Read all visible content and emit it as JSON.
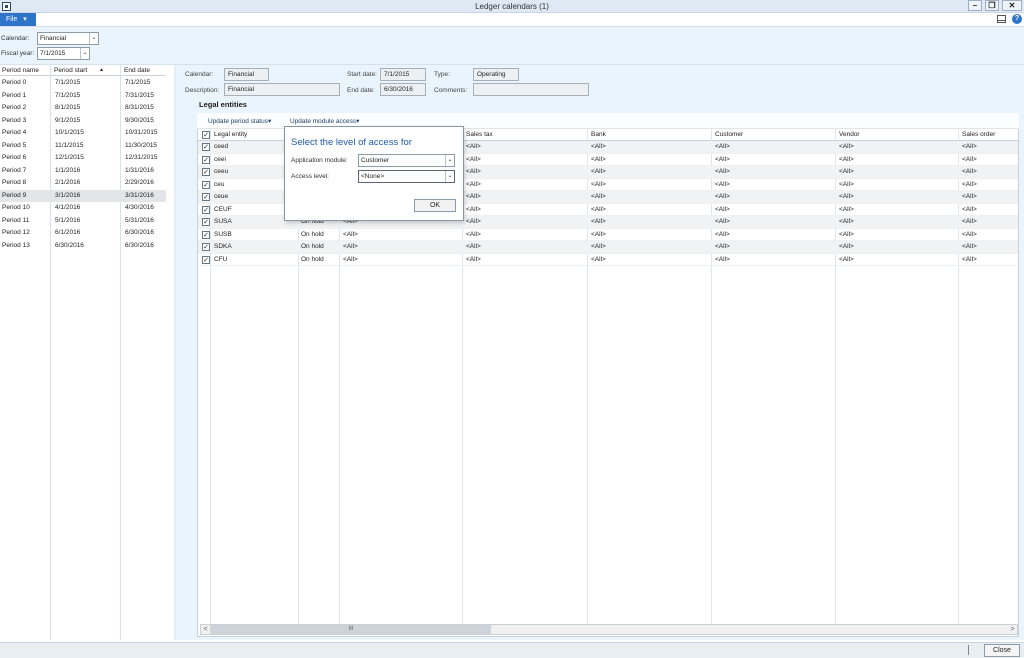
{
  "window": {
    "title": "Ledger calendars (1)",
    "minimize_glyph": "–",
    "restore_glyph": "❐",
    "close_glyph": "✕"
  },
  "ribbon": {
    "file_label": "File",
    "file_arrow": "▾",
    "help_glyph": "?"
  },
  "filters": {
    "calendar_label": "Calendar:",
    "calendar_value": "Financial",
    "fiscal_year_label": "Fiscal year:",
    "fiscal_year_value": "7/1/2015",
    "dropdown_glyph": "⌄"
  },
  "periods": {
    "headers": {
      "name": "Period name",
      "start": "Period start",
      "end": "End date",
      "sort_glyph": "▲"
    },
    "selected_index": 9,
    "rows": [
      {
        "name": "Period 0",
        "start": "7/1/2015",
        "end": "7/1/2015"
      },
      {
        "name": "Period 1",
        "start": "7/1/2015",
        "end": "7/31/2015"
      },
      {
        "name": "Period 2",
        "start": "8/1/2015",
        "end": "8/31/2015"
      },
      {
        "name": "Period 3",
        "start": "9/1/2015",
        "end": "9/30/2015"
      },
      {
        "name": "Period 4",
        "start": "10/1/2015",
        "end": "10/31/2015"
      },
      {
        "name": "Period 5",
        "start": "11/1/2015",
        "end": "11/30/2015"
      },
      {
        "name": "Period 6",
        "start": "12/1/2015",
        "end": "12/31/2015"
      },
      {
        "name": "Period 7",
        "start": "1/1/2016",
        "end": "1/31/2016"
      },
      {
        "name": "Period 8",
        "start": "2/1/2016",
        "end": "2/29/2016"
      },
      {
        "name": "Period 9",
        "start": "3/1/2016",
        "end": "3/31/2016"
      },
      {
        "name": "Period 10",
        "start": "4/1/2016",
        "end": "4/30/2016"
      },
      {
        "name": "Period 11",
        "start": "5/1/2016",
        "end": "5/31/2016"
      },
      {
        "name": "Period 12",
        "start": "6/1/2016",
        "end": "6/30/2016"
      },
      {
        "name": "Period 13",
        "start": "6/30/2016",
        "end": "6/30/2016"
      }
    ]
  },
  "details": {
    "calendar_label": "Calendar:",
    "calendar_value": "Financial",
    "description_label": "Description:",
    "description_value": "Financial",
    "start_date_label": "Start date:",
    "start_date_value": "7/1/2015",
    "end_date_label": "End date:",
    "end_date_value": "6/30/2016",
    "type_label": "Type:",
    "type_value": "Operating",
    "comments_label": "Comments:",
    "comments_value": ""
  },
  "legal_entities": {
    "title": "Legal entities",
    "toolbar": {
      "update_period_status": "Update period status",
      "update_module_access": "Update module access",
      "dropdown_glyph": "▾"
    },
    "headers": {
      "legal_entity": "Legal entity",
      "sales_tax": "Sales tax",
      "bank": "Bank",
      "customer": "Customer",
      "vendor": "Vendor",
      "sales_order": "Sales order"
    },
    "check_glyph": "✓",
    "rows": [
      {
        "entity": "ceed",
        "status": "",
        "v1": "",
        "v2": "<All>",
        "v3": "<All>",
        "v4": "<All>",
        "v5": "<All>",
        "v6": "<All>"
      },
      {
        "entity": "ceei",
        "status": "",
        "v1": "",
        "v2": "<All>",
        "v3": "<All>",
        "v4": "<All>",
        "v5": "<All>",
        "v6": "<All>"
      },
      {
        "entity": "ceeu",
        "status": "",
        "v1": "",
        "v2": "<All>",
        "v3": "<All>",
        "v4": "<All>",
        "v5": "<All>",
        "v6": "<All>"
      },
      {
        "entity": "ceu",
        "status": "",
        "v1": "",
        "v2": "<All>",
        "v3": "<All>",
        "v4": "<All>",
        "v5": "<All>",
        "v6": "<All>"
      },
      {
        "entity": "ceue",
        "status": "",
        "v1": "",
        "v2": "<All>",
        "v3": "<All>",
        "v4": "<All>",
        "v5": "<All>",
        "v6": "<All>"
      },
      {
        "entity": "CEUF",
        "status": "",
        "v1": "",
        "v2": "<All>",
        "v3": "<All>",
        "v4": "<All>",
        "v5": "<All>",
        "v6": "<All>"
      },
      {
        "entity": "SUSA",
        "status": "On hold",
        "v1": "<All>",
        "v2": "<All>",
        "v3": "<All>",
        "v4": "<All>",
        "v5": "<All>",
        "v6": "<All>"
      },
      {
        "entity": "SUSB",
        "status": "On hold",
        "v1": "<All>",
        "v2": "<All>",
        "v3": "<All>",
        "v4": "<All>",
        "v5": "<All>",
        "v6": "<All>"
      },
      {
        "entity": "SDKA",
        "status": "On hold",
        "v1": "<All>",
        "v2": "<All>",
        "v3": "<All>",
        "v4": "<All>",
        "v5": "<All>",
        "v6": "<All>"
      },
      {
        "entity": "CFU",
        "status": "On hold",
        "v1": "<All>",
        "v2": "<All>",
        "v3": "<All>",
        "v4": "<All>",
        "v5": "<All>",
        "v6": "<All>"
      }
    ]
  },
  "scrollbar": {
    "left_arrow": "<",
    "right_arrow": ">",
    "grip": "III"
  },
  "popup": {
    "title": "Select the level of access for",
    "module_label": "Application module:",
    "module_value": "Customer",
    "access_label": "Access level:",
    "access_value": "<None>",
    "ok_label": "OK"
  },
  "status_bar": {
    "close_label": "Close"
  },
  "colors": {
    "accent": "#2e74c9",
    "pane_background": "#eaf4fc",
    "selected_row": "#e3e5e8"
  }
}
